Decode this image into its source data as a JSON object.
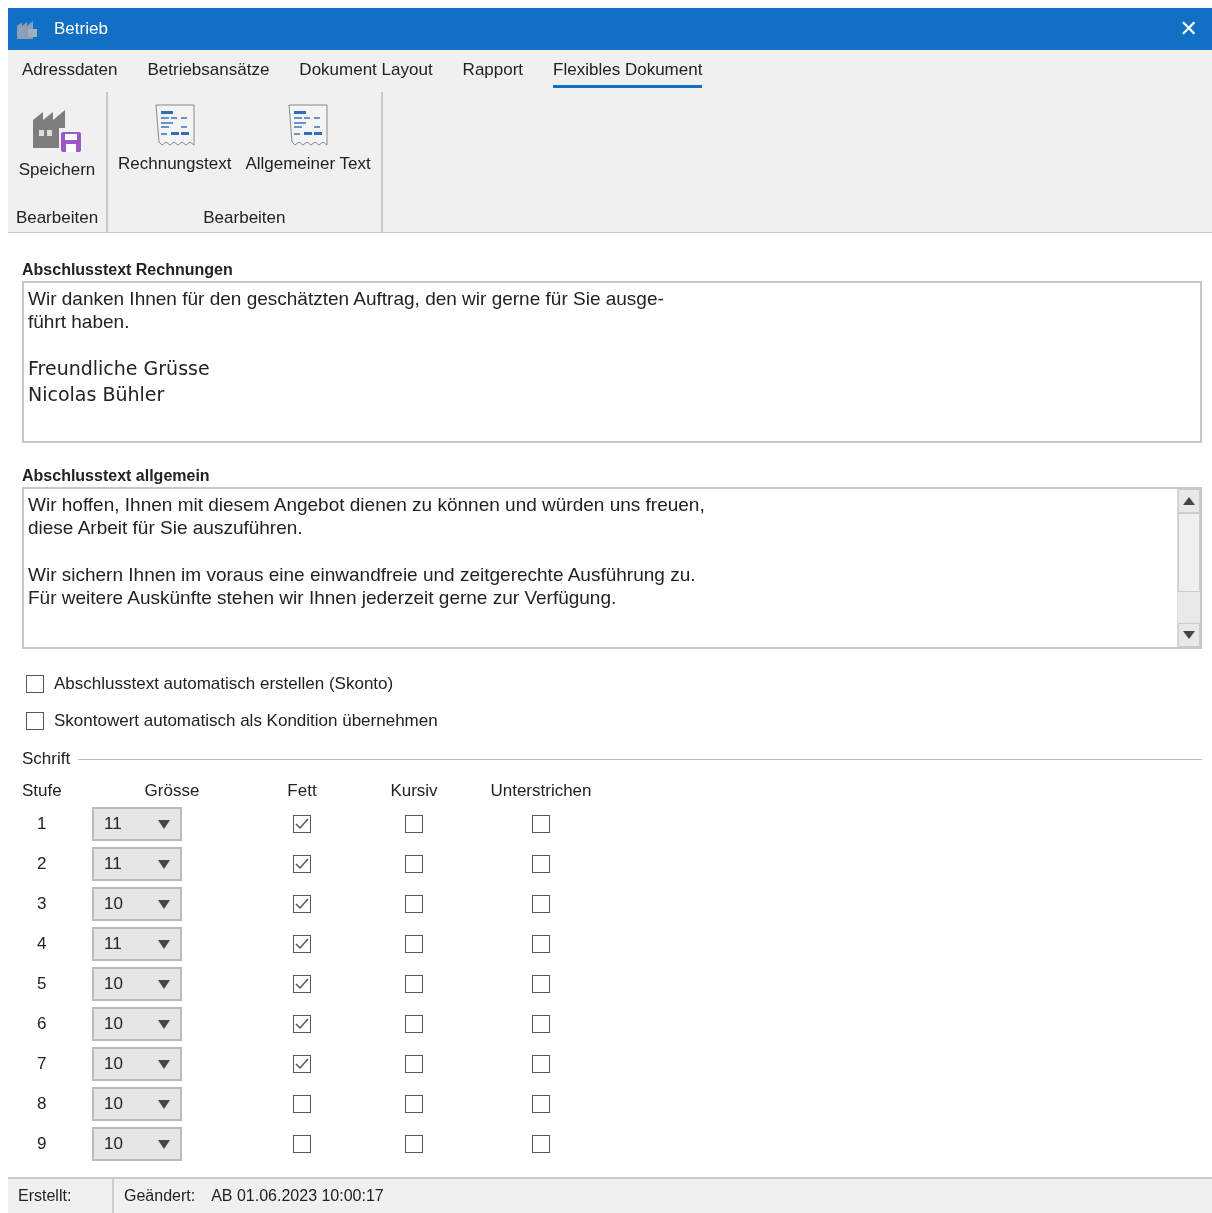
{
  "window": {
    "title": "Betrieb",
    "close": "✕"
  },
  "tabs": [
    {
      "label": "Adressdaten",
      "selected": false
    },
    {
      "label": "Betriebsansätze",
      "selected": false
    },
    {
      "label": "Dokument Layout",
      "selected": false
    },
    {
      "label": "Rapport",
      "selected": false
    },
    {
      "label": "Flexibles Dokument",
      "selected": true
    }
  ],
  "ribbon_groups": [
    {
      "label": "Bearbeiten",
      "buttons": [
        {
          "label": "Speichern",
          "kind": "save"
        }
      ]
    },
    {
      "label": "Bearbeiten",
      "buttons": [
        {
          "label": "Rechnungstext",
          "kind": "document"
        },
        {
          "label": "Allgemeiner Text",
          "kind": "document"
        }
      ]
    }
  ],
  "text_fields": [
    {
      "label": "Abschlusstext Rechnungen",
      "scrollbar": false,
      "paragraphs": [
        {
          "kind": "plain",
          "lines": [
            "Wir danken Ihnen für den geschätzten Auftrag, den wir gerne für Sie ausge-",
            "führt haben."
          ]
        },
        {
          "kind": "ui",
          "lines": [
            "Freundliche Grüsse",
            "Nicolas Bühler"
          ]
        }
      ]
    },
    {
      "label": "Abschlusstext allgemein",
      "scrollbar": true,
      "paragraphs": [
        {
          "kind": "plain",
          "lines": [
            "Wir hoffen, Ihnen mit diesem Angebot dienen zu können und würden uns freuen,",
            "diese Arbeit für Sie auszuführen."
          ]
        },
        {
          "kind": "plain",
          "lines": [
            "Wir sichern Ihnen im voraus eine einwandfreie und zeitgerechte Ausführung zu.",
            "Für weitere Auskünfte stehen wir Ihnen jederzeit gerne zur Verfügung."
          ]
        }
      ]
    }
  ],
  "options": [
    {
      "label": "Abschlusstext automatisch erstellen (Skonto)",
      "checked": false
    },
    {
      "label": "Skontowert automatisch als Kondition übernehmen",
      "checked": false
    }
  ],
  "font_group": {
    "title": "Schrift",
    "columns": [
      "Stufe",
      "Grösse",
      "Fett",
      "Kursiv",
      "Unterstrichen"
    ],
    "rows": [
      {
        "level": "1",
        "size": "11",
        "bold": true,
        "italic": false,
        "underline": false
      },
      {
        "level": "2",
        "size": "11",
        "bold": true,
        "italic": false,
        "underline": false
      },
      {
        "level": "3",
        "size": "10",
        "bold": true,
        "italic": false,
        "underline": false
      },
      {
        "level": "4",
        "size": "11",
        "bold": true,
        "italic": false,
        "underline": false
      },
      {
        "level": "5",
        "size": "10",
        "bold": true,
        "italic": false,
        "underline": false
      },
      {
        "level": "6",
        "size": "10",
        "bold": true,
        "italic": false,
        "underline": false
      },
      {
        "level": "7",
        "size": "10",
        "bold": true,
        "italic": false,
        "underline": false
      },
      {
        "level": "8",
        "size": "10",
        "bold": false,
        "italic": false,
        "underline": false
      },
      {
        "level": "9",
        "size": "10",
        "bold": false,
        "italic": false,
        "underline": false
      }
    ]
  },
  "status_bar": {
    "created_label": "Erstellt:",
    "changed_label": "Geändert:",
    "changed_value": "AB 01.06.2023 10:00:17"
  }
}
